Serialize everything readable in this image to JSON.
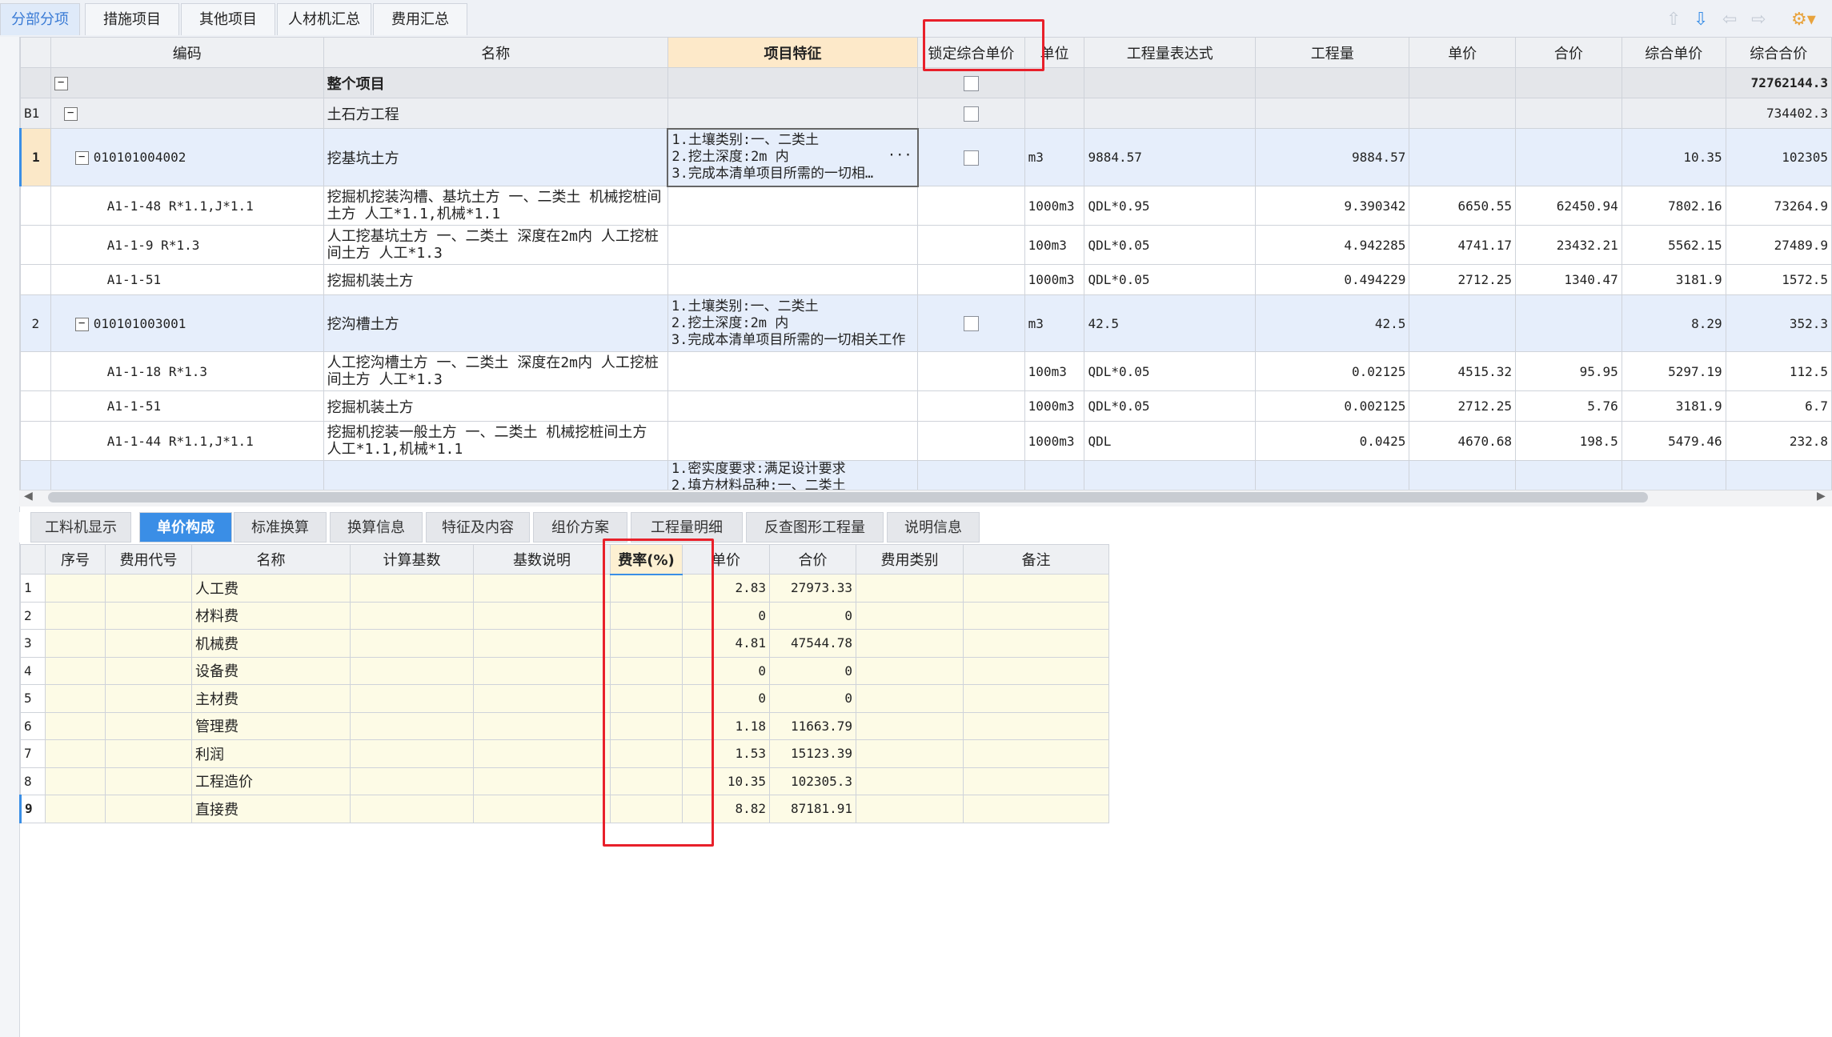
{
  "top_tabs": [
    "分部分项",
    "措施项目",
    "其他项目",
    "人材机汇总",
    "费用汇总"
  ],
  "columns": [
    "编码",
    "名称",
    "项目特征",
    "锁定综合单价",
    "单位",
    "工程量表达式",
    "工程量",
    "单价",
    "合价",
    "综合单价",
    "综合合价"
  ],
  "rows": {
    "r0": {
      "code": "",
      "name": "整个项目",
      "total": "72762144.3"
    },
    "r1": {
      "idx": "B1",
      "name": "土石方工程",
      "total": "734402.3"
    },
    "r2": {
      "idx": "1",
      "code": "010101004002",
      "name": "挖基坑土方",
      "feature": "1.土壤类别:一、二类土\n2.挖土深度:2m 内\n3.完成本清单项目所需的一切相…",
      "more": "···",
      "unit": "m3",
      "expr": "9884.57",
      "qty": "9884.57",
      "price": "",
      "amount": "",
      "unit_price": "10.35",
      "total": "102305"
    },
    "r3": {
      "code": "A1-1-48 R*1.1,J*1.1",
      "name": "挖掘机挖装沟槽、基坑土方 一、二类土  机械挖桩间土方 人工*1.1,机械*1.1",
      "unit": "1000m3",
      "expr": "QDL*0.95",
      "qty": "9.390342",
      "price": "6650.55",
      "amount": "62450.94",
      "unit_price": "7802.16",
      "total": "73264.9"
    },
    "r4": {
      "code": "A1-1-9 R*1.3",
      "name": "人工挖基坑土方 一、二类土 深度在2m内  人工挖桩间土方 人工*1.3",
      "unit": "100m3",
      "expr": "QDL*0.05",
      "qty": "4.942285",
      "price": "4741.17",
      "amount": "23432.21",
      "unit_price": "5562.15",
      "total": "27489.9"
    },
    "r5": {
      "code": "A1-1-51",
      "name": "挖掘机装土方",
      "unit": "1000m3",
      "expr": "QDL*0.05",
      "qty": "0.494229",
      "price": "2712.25",
      "amount": "1340.47",
      "unit_price": "3181.9",
      "total": "1572.5"
    },
    "r6": {
      "idx": "2",
      "code": "010101003001",
      "name": "挖沟槽土方",
      "feature": "1.土壤类别:一、二类土\n2.挖土深度:2m 内\n3.完成本清单项目所需的一切相关工作",
      "unit": "m3",
      "expr": "42.5",
      "qty": "42.5",
      "price": "",
      "amount": "",
      "unit_price": "8.29",
      "total": "352.3"
    },
    "r7": {
      "code": "A1-1-18 R*1.3",
      "name": "人工挖沟槽土方 一、二类土 深度在2m内  人工挖桩间土方 人工*1.3",
      "unit": "100m3",
      "expr": "QDL*0.05",
      "qty": "0.02125",
      "price": "4515.32",
      "amount": "95.95",
      "unit_price": "5297.19",
      "total": "112.5"
    },
    "r8": {
      "code": "A1-1-51",
      "name": "挖掘机装土方",
      "unit": "1000m3",
      "expr": "QDL*0.05",
      "qty": "0.002125",
      "price": "2712.25",
      "amount": "5.76",
      "unit_price": "3181.9",
      "total": "6.7"
    },
    "r9": {
      "code": "A1-1-44 R*1.1,J*1.1",
      "name": "挖掘机挖装一般土方 一、二类土  机械挖桩间土方 人工*1.1,机械*1.1",
      "unit": "1000m3",
      "expr": "QDL",
      "qty": "0.0425",
      "price": "4670.68",
      "amount": "198.5",
      "unit_price": "5479.46",
      "total": "232.8"
    },
    "r10": {
      "feature": "1.密实度要求:满足设计要求\n2.填方材料品种:一、二类土"
    }
  },
  "bottom_tabs": [
    "工料机显示",
    "单价构成",
    "标准换算",
    "换算信息",
    "特征及内容",
    "组价方案",
    "工程量明细",
    "反查图形工程量",
    "说明信息"
  ],
  "sub_columns": [
    "序号",
    "费用代号",
    "名称",
    "计算基数",
    "基数说明",
    "费率(%)",
    "单价",
    "合价",
    "费用类别",
    "备注"
  ],
  "sub_rows": [
    {
      "idx": "1",
      "name": "人工费",
      "price": "2.83",
      "amount": "27973.33"
    },
    {
      "idx": "2",
      "name": "材料费",
      "price": "0",
      "amount": "0"
    },
    {
      "idx": "3",
      "name": "机械费",
      "price": "4.81",
      "amount": "47544.78"
    },
    {
      "idx": "4",
      "name": "设备费",
      "price": "0",
      "amount": "0"
    },
    {
      "idx": "5",
      "name": "主材费",
      "price": "0",
      "amount": "0"
    },
    {
      "idx": "6",
      "name": "管理费",
      "price": "1.18",
      "amount": "11663.79"
    },
    {
      "idx": "7",
      "name": "利润",
      "price": "1.53",
      "amount": "15123.39"
    },
    {
      "idx": "8",
      "name": "工程造价",
      "price": "10.35",
      "amount": "102305.3"
    },
    {
      "idx": "9",
      "name": "直接费",
      "price": "8.82",
      "amount": "87181.91"
    }
  ],
  "colors": {
    "accent": "#3a8ee6",
    "highlight": "#e8202a",
    "active_row": "#e6eefb",
    "sub_cell": "#fdfbe6"
  }
}
